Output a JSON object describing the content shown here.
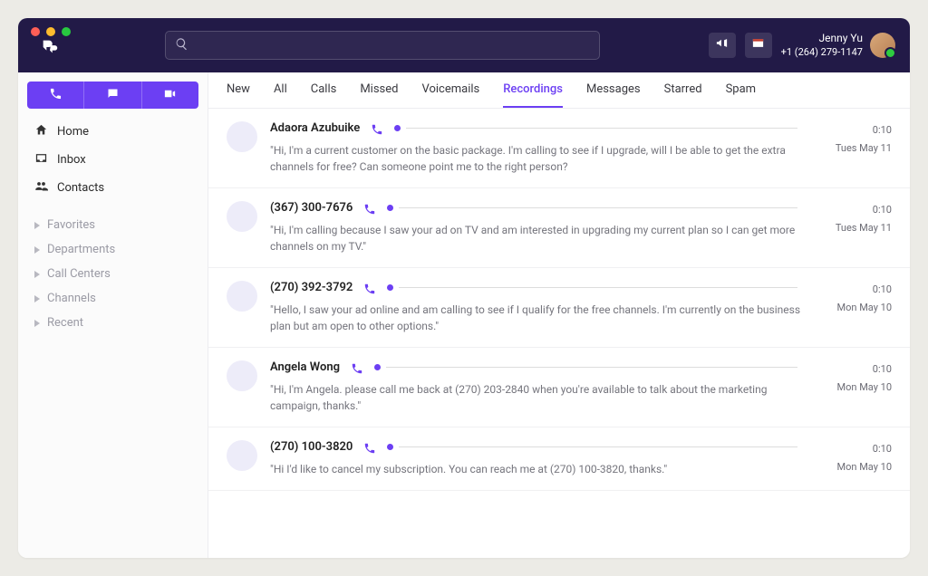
{
  "header": {
    "search_placeholder": "",
    "user_name": "Jenny Yu",
    "user_phone": "+1 (264) 279-1147"
  },
  "sidebar": {
    "nav": [
      {
        "icon": "home",
        "label": "Home"
      },
      {
        "icon": "inbox",
        "label": "Inbox"
      },
      {
        "icon": "contacts",
        "label": "Contacts"
      }
    ],
    "groups": [
      {
        "label": "Favorites"
      },
      {
        "label": "Departments"
      },
      {
        "label": "Call Centers"
      },
      {
        "label": "Channels"
      },
      {
        "label": "Recent"
      }
    ]
  },
  "tabs": [
    {
      "label": "New",
      "active": false
    },
    {
      "label": "All",
      "active": false
    },
    {
      "label": "Calls",
      "active": false
    },
    {
      "label": "Missed",
      "active": false
    },
    {
      "label": "Voicemails",
      "active": false
    },
    {
      "label": "Recordings",
      "active": true
    },
    {
      "label": "Messages",
      "active": false
    },
    {
      "label": "Starred",
      "active": false
    },
    {
      "label": "Spam",
      "active": false
    }
  ],
  "recordings": [
    {
      "name": "Adaora Azubuike",
      "duration": "0:10",
      "date": "Tues May 11",
      "transcript": "\"Hi, I'm a current customer on the basic package. I'm calling to see if I upgrade, will I be able to get the extra channels for free? Can someone point me to the right person?"
    },
    {
      "name": "(367) 300-7676",
      "duration": "0:10",
      "date": "Tues May 11",
      "transcript": "\"Hi, I'm calling because I saw your ad on TV and am interested in upgrading my current plan so I can get more channels on my TV.\""
    },
    {
      "name": "(270) 392-3792",
      "duration": "0:10",
      "date": "Mon May 10",
      "transcript": "\"Hello, I saw your ad online and am calling to see if I qualify for the free channels. I'm currently on the business plan but am open to other options.\""
    },
    {
      "name": "Angela Wong",
      "duration": "0:10",
      "date": "Mon May 10",
      "transcript": "\"Hi, I'm Angela. please call me back at (270) 203-2840 when you're available to talk about the marketing campaign, thanks.\""
    },
    {
      "name": "(270) 100-3820",
      "duration": "0:10",
      "date": "Mon May 10",
      "transcript": "\"Hi I'd like to cancel my subscription. You can reach me at (270) 100-3820, thanks.\""
    }
  ]
}
